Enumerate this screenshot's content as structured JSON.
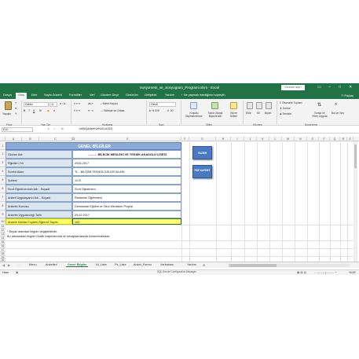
{
  "window": {
    "title": "Sosyometri_ve_Sosyogram_Programi.xlsm - Excel",
    "signin": "Oturum açın"
  },
  "tabs": [
    "Dosya",
    "Giriş",
    "Ekle",
    "Sayfa Düzeni",
    "Formüller",
    "Veri",
    "Gözden Geçir",
    "Görünüm",
    "Geliştirici",
    "Yardım",
    "Ne yapmak istediğinizi söyleyin"
  ],
  "share": "Paylaş",
  "ribbon": {
    "paste": "Yapıştır",
    "clipboard": "Pano",
    "font_name": "Calibri",
    "font_size": "11",
    "font_group": "Yazı Tipi",
    "wrap": "Metni Kaydır",
    "merge": "Birleştir ve Ortala",
    "align_group": "Hizalama",
    "number_format": "Genel",
    "number_group": "Sayı",
    "cond_format": "Koşullu Biçimlendirme",
    "table_format": "Tablo Olarak Biçimlendir",
    "cell_styles": "Hücre Stilleri",
    "styles_group": "Stiller",
    "insert": "Ekle",
    "delete": "Sil",
    "format": "Biçim",
    "cells_group": "Hücreler",
    "autosum": "Otomatik Toplam",
    "fill": "Doldur",
    "clear": "Temizle",
    "sort": "Sırala ve Filtre Uygula",
    "find": "Bul ve Seç",
    "edit_group": "Düzenleme"
  },
  "formula_bar": {
    "name_box": "E10",
    "formula": "=MAK(Anket!Veri!A3:A102)"
  },
  "columns": [
    "A",
    "B",
    "C",
    "D",
    "E",
    "F",
    "G",
    "H",
    "I",
    "J",
    "K",
    "L",
    "M",
    "N",
    "O",
    "P",
    "Q",
    "R",
    "S"
  ],
  "rows": [
    "1",
    "2",
    "3",
    "4",
    "5",
    "6",
    "7",
    "8",
    "9",
    "10",
    "11",
    "12",
    "13",
    "14",
    "15",
    "16",
    "17",
    "18",
    "19",
    "20"
  ],
  "sheet": {
    "header": "GENEL BİLGİLER",
    "fields": [
      {
        "label": "Okulun Adı",
        "value": "..........  BİLECİK MESLEKİ VE TEKNİK ANADOLU LİSESİ"
      },
      {
        "label": "Öğretim Yılı",
        "value": "2016-2017"
      },
      {
        "label": "Sınıfın Alanı",
        "value": "TL - BİLİŞİM TEKNOLOJİLERİ ALANI"
      },
      {
        "label": "Şubesi",
        "value": "12 B"
      },
      {
        "label": "Sınıf Öğretmeninin Adı - Soyadı",
        "value": "Sınıf Öğretmeni"
      },
      {
        "label": "Anketi Uygulayanın Adı - Soyadı",
        "value": "Rehberlik Öğretmeni"
      },
      {
        "label": "Anketin Konusu",
        "value": "Demokrasi Eğitimi ve Okul Meclisleri Projesi"
      },
      {
        "label": "Anketin Uygulandığı Tarih",
        "value": "25.02.2017"
      },
      {
        "label": "Ankete Katılan Toplam Öğrenci Sayısı",
        "value": "100"
      }
    ],
    "note1": "* Beyaz alandaki bilgiler değiştirilebilir.",
    "note2": "Bu alanlardaki bilgiler Grafik başlıklarında ve hesaplamalarda kullanılmaktadır."
  },
  "buttons": {
    "print": "YAZDIR",
    "pdf": "PDF KAYDET"
  },
  "sheet_tabs": [
    "Menu",
    "Anketleri",
    "Genel Bilgiler",
    "Ni_Liste",
    "Ps_Liste",
    "Anket_Formu",
    "Veritabanı",
    "Yardım"
  ],
  "active_sheet": "Genel Bilgiler",
  "status": {
    "mode": "Hazır",
    "taskbar": "SQL Server Configuration Manager",
    "zoom": "%100"
  },
  "colors": {
    "excel_green": "#217346",
    "label_fill": "#dce6f1",
    "header_fill": "#8eaadb",
    "highlight": "#ffff66",
    "button": "#4a79c3"
  }
}
